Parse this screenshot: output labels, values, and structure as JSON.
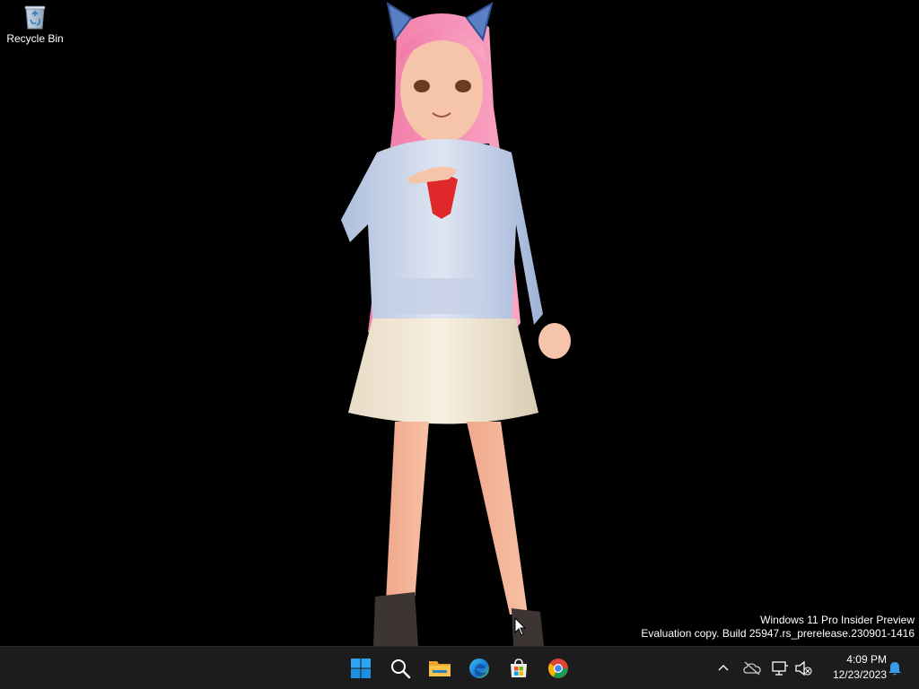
{
  "desktop": {
    "icons": [
      {
        "label": "Recycle Bin",
        "icon": "recycle-bin-icon"
      }
    ],
    "wallpaper": {
      "description_icon": "anime-character-wallpaper",
      "background": "#000000"
    },
    "watermark": {
      "line1": "Windows 11 Pro Insider Preview",
      "line2": "Evaluation copy. Build 25947.rs_prerelease.230901-1416"
    }
  },
  "taskbar": {
    "background": "#1c1c1c",
    "pinned": [
      {
        "name": "start",
        "icon": "windows-start-icon"
      },
      {
        "name": "search",
        "icon": "search-icon"
      },
      {
        "name": "file-explorer",
        "icon": "folder-icon"
      },
      {
        "name": "edge",
        "icon": "edge-icon"
      },
      {
        "name": "store",
        "icon": "store-icon"
      },
      {
        "name": "chrome",
        "icon": "chrome-icon"
      }
    ],
    "tray": {
      "icons": [
        "chevron-up-icon",
        "onedrive-offline-icon",
        "network-icon",
        "volume-muted-icon"
      ],
      "time": "4:09 PM",
      "date": "12/23/2023",
      "notification_icon": "bell-icon"
    }
  },
  "colors": {
    "accent": "#0078d4",
    "start_blue": "#2ea3f2",
    "folder_yellow": "#f7c34a"
  }
}
